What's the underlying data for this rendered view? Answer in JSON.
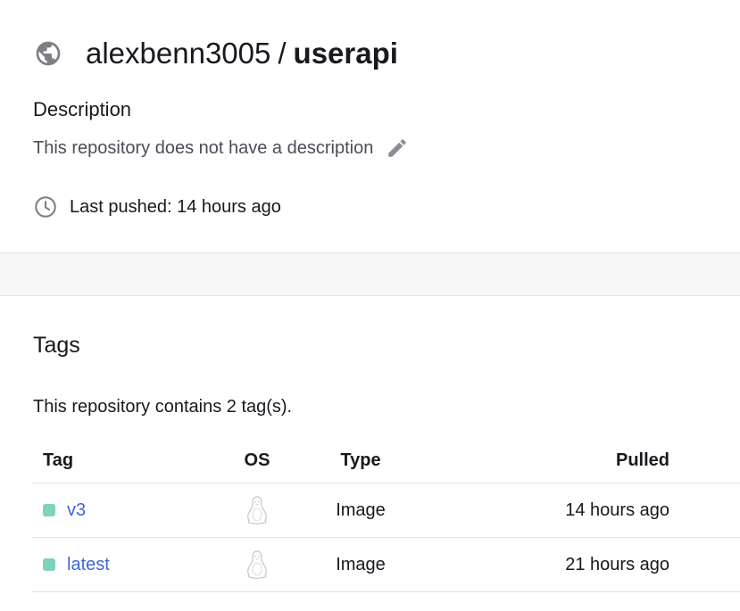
{
  "repo": {
    "namespace": "alexbenn3005",
    "separator": "/",
    "name": "userapi",
    "visibility_icon": "globe-icon"
  },
  "description": {
    "title": "Description",
    "text": "This repository does not have a description",
    "edit_icon": "pencil-icon"
  },
  "last_pushed": {
    "icon": "clock-icon",
    "text": "Last pushed: 14 hours ago"
  },
  "tags": {
    "title": "Tags",
    "count_text": "This repository contains 2 tag(s).",
    "columns": [
      "Tag",
      "OS",
      "Type",
      "Pulled"
    ],
    "rows": [
      {
        "tag": "v3",
        "os_icon": "linux-icon",
        "type": "Image",
        "pulled": "14 hours ago"
      },
      {
        "tag": "latest",
        "os_icon": "linux-icon",
        "type": "Image",
        "pulled": "21 hours ago"
      }
    ],
    "tag_dot_color": "#7fd3bd",
    "link_color": "#3e66db"
  }
}
